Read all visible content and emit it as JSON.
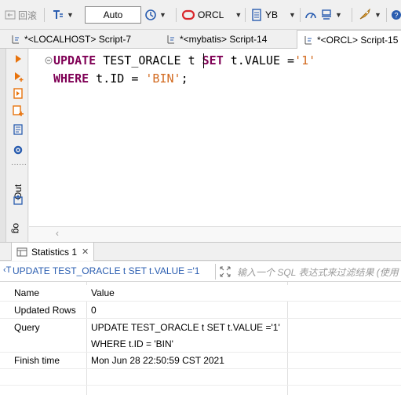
{
  "toolbar": {
    "rollback_label": "回滚",
    "mode_value": "Auto",
    "connection_label": "ORCL",
    "schema_label": "YB"
  },
  "tabs": [
    {
      "label": "*<LOCALHOST> Script-7"
    },
    {
      "label": "*<mybatis> Script-14"
    },
    {
      "label": "*<ORCL> Script-15"
    }
  ],
  "sidebar": {
    "out_label": "Out",
    "log_label": "og"
  },
  "editor": {
    "line1": {
      "kw1": "UPDATE",
      "t1": " TEST_ORACLE ",
      "t2": "t",
      "sp": " ",
      "kw2": "SET",
      "t3": " t.VALUE =",
      "s1": "'1'"
    },
    "line2": {
      "kw1": "WHERE",
      "t1": " t.ID = ",
      "s1": "'BIN'",
      "t2": ";"
    }
  },
  "results": {
    "tab_label": "Statistics 1",
    "filter_sql": "UPDATE TEST_ORACLE t SET t.VALUE ='1",
    "filter_placeholder": "输入一个 SQL 表达式来过滤结果 (使用",
    "columns": [
      "Name",
      "Value"
    ],
    "rows": [
      {
        "name": "Updated Rows",
        "value": "0"
      },
      {
        "name": "Query",
        "value": "UPDATE TEST_ORACLE t SET t.VALUE ='1'"
      },
      {
        "name": "",
        "value": "WHERE t.ID = 'BIN'"
      },
      {
        "name": "Finish time",
        "value": "Mon Jun 28 22:50:59 CST 2021"
      }
    ]
  },
  "colors": {
    "keyword": "#7f0055",
    "string": "#d2691e",
    "accent_red": "#d9262b",
    "accent_blue": "#2a5db0"
  }
}
